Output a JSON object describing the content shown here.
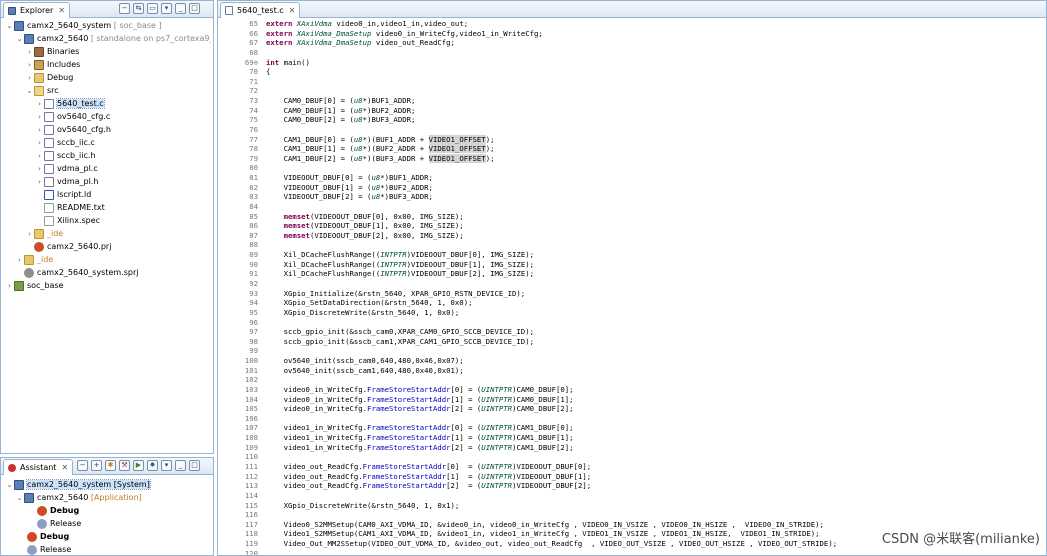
{
  "explorer": {
    "tab_label": "Explorer",
    "tab_close": "✕",
    "items": [
      {
        "label": "camx2_5640_system",
        "suffix": "[ soc_base ]",
        "icon": "project-icon"
      },
      {
        "label": "camx2_5640",
        "suffix": "[ standalone on ps7_cortexa9_0 ]",
        "icon": "project-icon"
      },
      {
        "label": "Binaries",
        "icon": "binaries-icon"
      },
      {
        "label": "Includes",
        "icon": "includes-icon"
      },
      {
        "label": "Debug",
        "icon": "folder-icon"
      },
      {
        "label": "src",
        "icon": "folder-open-icon"
      },
      {
        "label": "5640_test.c",
        "icon": "c-file-icon"
      },
      {
        "label": "ov5640_cfg.c",
        "icon": "c-file-icon"
      },
      {
        "label": "ov5640_cfg.h",
        "icon": "h-file-icon"
      },
      {
        "label": "sccb_iic.c",
        "icon": "c-file-icon"
      },
      {
        "label": "sccb_iic.h",
        "icon": "h-file-icon"
      },
      {
        "label": "vdma_pl.c",
        "icon": "c-file-icon"
      },
      {
        "label": "vdma_pl.h",
        "icon": "h-file-icon"
      },
      {
        "label": "lscript.ld",
        "icon": "linker-script-icon"
      },
      {
        "label": "README.txt",
        "icon": "text-file-icon"
      },
      {
        "label": "Xilinx.spec",
        "icon": "text-file-icon"
      },
      {
        "label": "_ide",
        "icon": "folder-icon"
      },
      {
        "label": "camx2_5640.prj",
        "icon": "prj-file-icon"
      },
      {
        "label": "_ide",
        "icon": "folder-icon"
      },
      {
        "label": "camx2_5640_system.sprj",
        "icon": "sprj-file-icon"
      },
      {
        "label": "soc_base",
        "icon": "bsp-icon"
      }
    ]
  },
  "assistant": {
    "tab_label": "Assistant",
    "tab_close": "✕",
    "items": [
      {
        "label": "camx2_5640_system [System]"
      },
      {
        "label": "camx2_5640",
        "suffix": "[Application]"
      },
      {
        "label": "Debug"
      },
      {
        "label": "Release"
      },
      {
        "label": "Debug"
      },
      {
        "label": "Release"
      }
    ]
  },
  "editor": {
    "tab_label": "5640_test.c",
    "tab_close": "✕",
    "line_numbers": [
      "65",
      "66",
      "67",
      "68",
      "69⊖",
      "70",
      "71",
      "72",
      "73",
      "74",
      "75",
      "76",
      "77",
      "78",
      "79",
      "80",
      "81",
      "82",
      "83",
      "84",
      "85",
      "86",
      "87",
      "88",
      "89",
      "90",
      "91",
      "92",
      "93",
      "94",
      "95",
      "96",
      "97",
      "98",
      "99",
      "100",
      "101",
      "102",
      "103",
      "104",
      "105",
      "106",
      "107",
      "108",
      "109",
      "110",
      "111",
      "112",
      "113",
      "114",
      "115",
      "116",
      "117",
      "118",
      "119",
      "120"
    ],
    "lines": [
      "extern XAxiVdma video0_in,video1_in,video_out;",
      "extern XAxiVdma_DmaSetup video0_in_WriteCfg,video1_in_WriteCfg;",
      "extern XAxiVdma_DmaSetup video_out_ReadCfg;",
      "",
      "int main()",
      "{",
      "",
      "",
      "    CAM0_DBUF[0] = (u8*)BUF1_ADDR;",
      "    CAM0_DBUF[1] = (u8*)BUF2_ADDR;",
      "    CAM0_DBUF[2] = (u8*)BUF3_ADDR;",
      "",
      "    CAM1_DBUF[0] = (u8*)(BUF1_ADDR + VIDEO1_OFFSET);",
      "    CAM1_DBUF[1] = (u8*)(BUF2_ADDR + VIDEO1_OFFSET);",
      "    CAM1_DBUF[2] = (u8*)(BUF3_ADDR + VIDEO1_OFFSET);",
      "",
      "    VIDEOOUT_DBUF[0] = (u8*)BUF1_ADDR;",
      "    VIDEOOUT_DBUF[1] = (u8*)BUF2_ADDR;",
      "    VIDEOOUT_DBUF[2] = (u8*)BUF3_ADDR;",
      "",
      "    memset(VIDEOOUT_DBUF[0], 0x00, IMG_SIZE);",
      "    memset(VIDEOOUT_DBUF[1], 0x00, IMG_SIZE);",
      "    memset(VIDEOOUT_DBUF[2], 0x00, IMG_SIZE);",
      "",
      "    Xil_DCacheFlushRange((INTPTR)VIDEOOUT_DBUF[0], IMG_SIZE);",
      "    Xil_DCacheFlushRange((INTPTR)VIDEOOUT_DBUF[1], IMG_SIZE);",
      "    Xil_DCacheFlushRange((INTPTR)VIDEOOUT_DBUF[2], IMG_SIZE);",
      "",
      "    XGpio_Initialize(&rstn_5640, XPAR_GPIO_RSTN_DEVICE_ID);",
      "    XGpio_SetDataDirection(&rstn_5640, 1, 0x0);",
      "    XGpio_DiscreteWrite(&rstn_5640, 1, 0x0);",
      "",
      "    sccb_gpio_init(&sscb_cam0,XPAR_CAM0_GPIO_SCCB_DEVICE_ID);",
      "    sccb_gpio_init(&sscb_cam1,XPAR_CAM1_GPIO_SCCB_DEVICE_ID);",
      "",
      "    ov5640_init(sscb_cam0,640,480,0x46,0x07);",
      "    ov5640_init(sscb_cam1,640,480,0x40,0x01);",
      "",
      "    video0_in_WriteCfg.FrameStoreStartAddr[0] = (UINTPTR)CAM0_DBUF[0];",
      "    video0_in_WriteCfg.FrameStoreStartAddr[1] = (UINTPTR)CAM0_DBUF[1];",
      "    video0_in_WriteCfg.FrameStoreStartAddr[2] = (UINTPTR)CAM0_DBUF[2];",
      "",
      "    video1_in_WriteCfg.FrameStoreStartAddr[0] = (UINTPTR)CAM1_DBUF[0];",
      "    video1_in_WriteCfg.FrameStoreStartAddr[1] = (UINTPTR)CAM1_DBUF[1];",
      "    video1_in_WriteCfg.FrameStoreStartAddr[2] = (UINTPTR)CAM1_DBUF[2];",
      "",
      "    video_out_ReadCfg.FrameStoreStartAddr[0]  = (UINTPTR)VIDEOOUT_DBUF[0];",
      "    video_out_ReadCfg.FrameStoreStartAddr[1]  = (UINTPTR)VIDEOOUT_DBUF[1];",
      "    video_out_ReadCfg.FrameStoreStartAddr[2]  = (UINTPTR)VIDEOOUT_DBUF[2];",
      "",
      "    XGpio_DiscreteWrite(&rstn_5640, 1, 0x1);",
      "",
      "    Video0_S2MMSetup(CAM0_AXI_VDMA_ID, &video0_in, video0_in_WriteCfg , VIDEO0_IN_VSIZE , VIDEO0_IN_HSIZE ,  VIDEO0_IN_STRIDE);",
      "    Video1_S2MMSetup(CAM1_AXI_VDMA_ID, &video1_in, video1_in_WriteCfg , VIDEO1_IN_VSIZE , VIDEO1_IN_HSIZE,  VIDEO1_IN_STRIDE);",
      "    Video_Out_MM2SSetup(VIDEO_OUT_VDMA_ID, &video_out, video_out_ReadCfg  , VIDEO_OUT_VSIZE , VIDEO_OUT_HSIZE , VIDEO_OUT_STRIDE);",
      ""
    ]
  },
  "watermark": "CSDN @米联客(milianke)"
}
